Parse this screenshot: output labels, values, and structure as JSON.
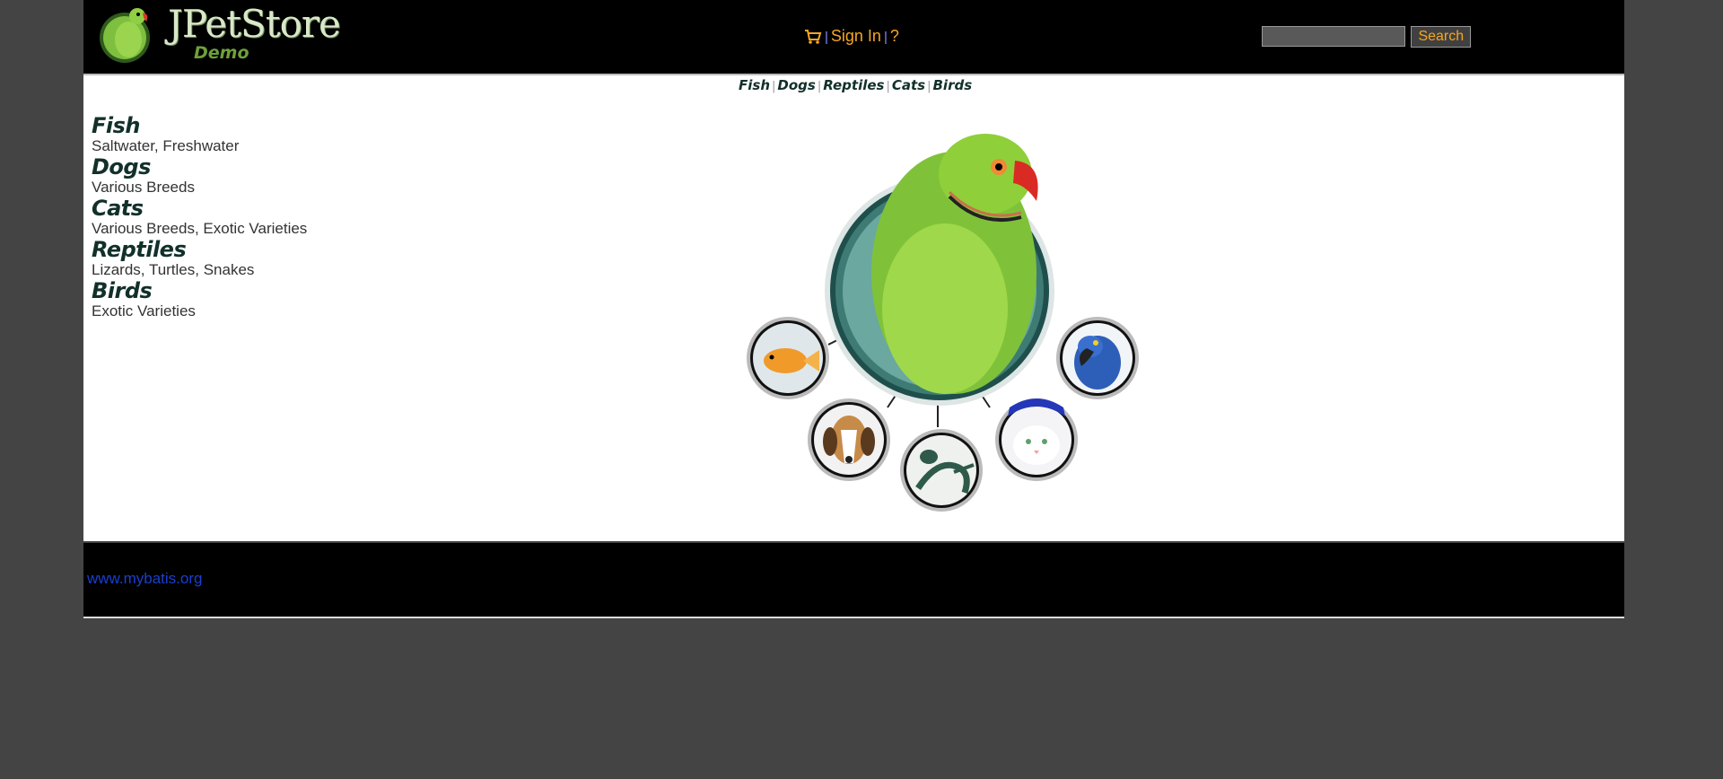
{
  "header": {
    "logo_title": "JPetStore",
    "logo_subtitle": "Demo",
    "cart_icon": "shopping-cart-icon",
    "separator": "|",
    "sign_in_label": "Sign In",
    "help_label": "?",
    "search_placeholder": "",
    "search_button_label": "Search"
  },
  "quick_links": {
    "fish": "Fish",
    "dogs": "Dogs",
    "reptiles": "Reptiles",
    "cats": "Cats",
    "birds": "Birds",
    "separator": "|"
  },
  "sidebar": {
    "categories": [
      {
        "title": "Fish",
        "desc": "Saltwater, Freshwater"
      },
      {
        "title": "Dogs",
        "desc": "Various Breeds"
      },
      {
        "title": "Cats",
        "desc": "Various Breeds, Exotic Varieties"
      },
      {
        "title": "Reptiles",
        "desc": "Lizards, Turtles, Snakes"
      },
      {
        "title": "Birds",
        "desc": "Exotic Varieties"
      }
    ]
  },
  "footer": {
    "link_text": "www.mybatis.org"
  },
  "colors": {
    "page_bg": "#444444",
    "header_bg": "#000000",
    "accent_orange": "#f5a623",
    "link_blue": "#1a3fd1",
    "category_green": "#12302a"
  }
}
